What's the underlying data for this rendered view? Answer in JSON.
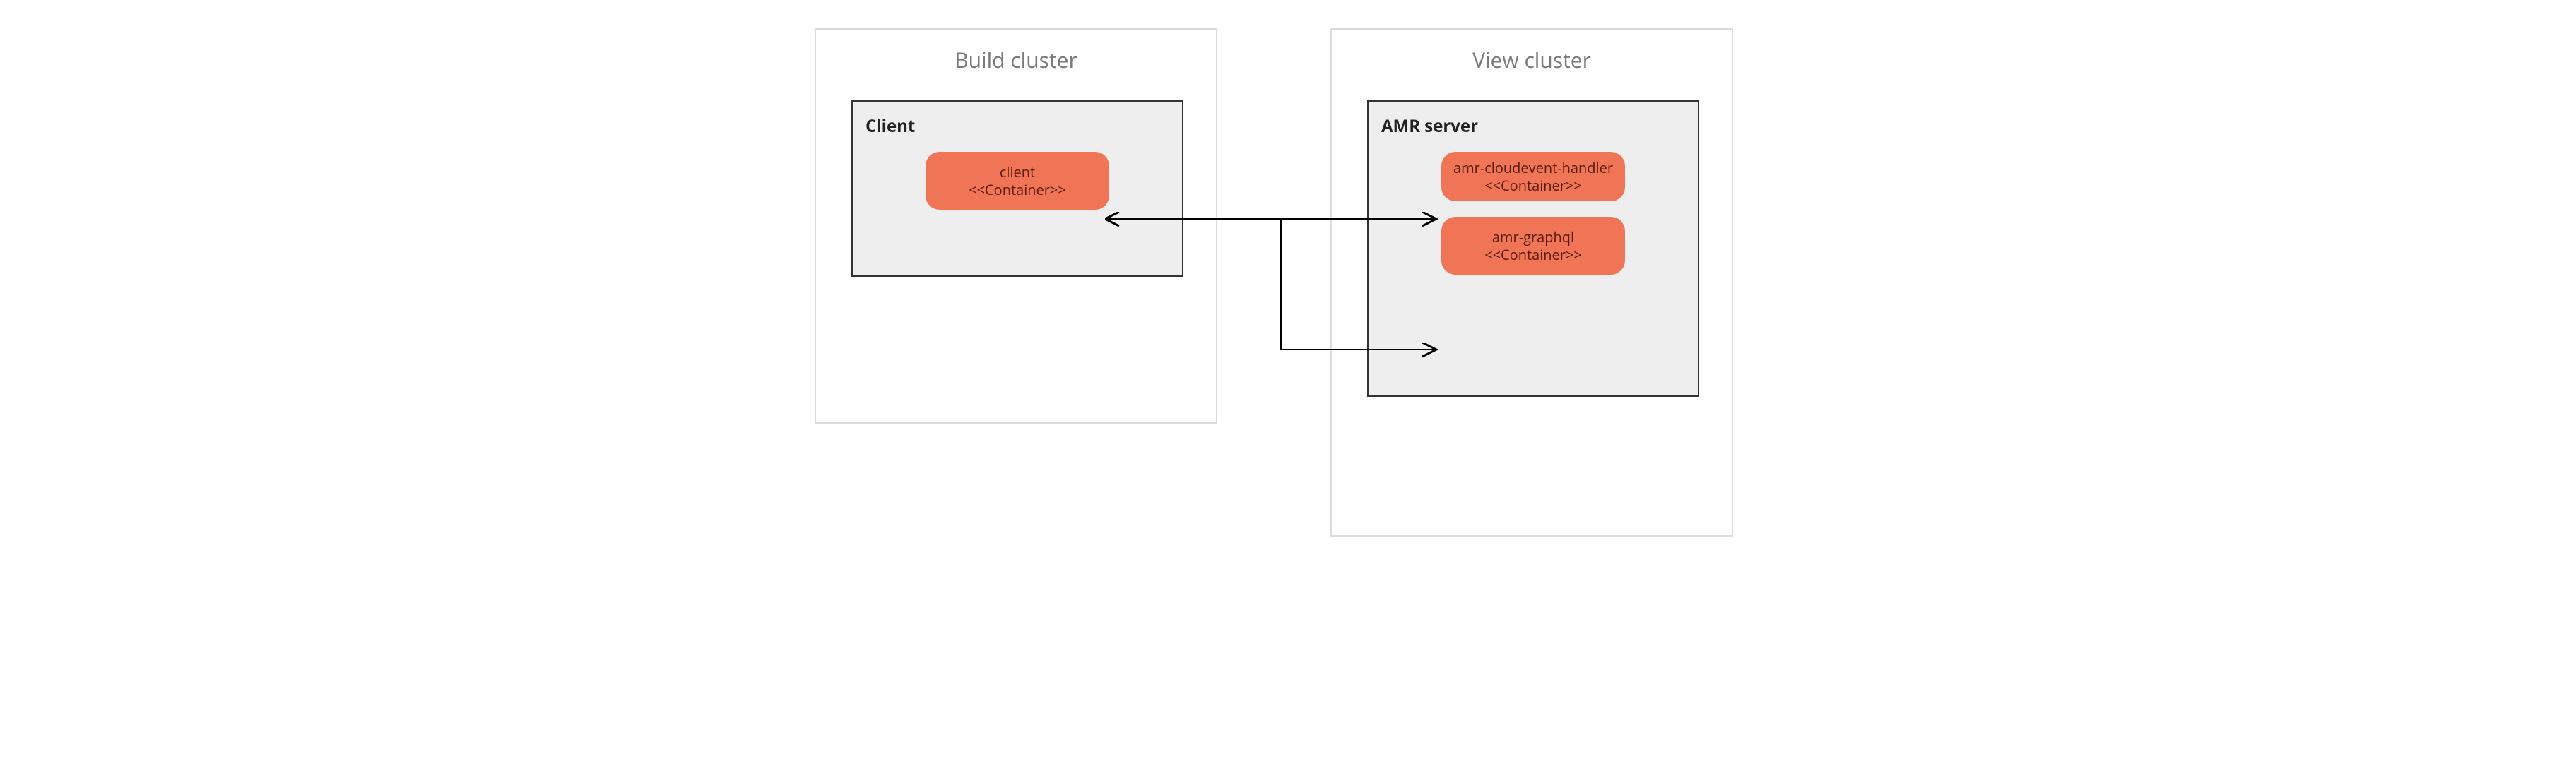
{
  "buildCluster": {
    "title": "Build cluster",
    "panel": {
      "title": "Client",
      "containers": [
        {
          "name": "client",
          "stereotype": "<<Container>>"
        }
      ]
    }
  },
  "viewCluster": {
    "title": "View cluster",
    "panel": {
      "title": "AMR server",
      "containers": [
        {
          "name": "amr-cloudevent-handler",
          "stereotype": "<<Container>>"
        },
        {
          "name": "amr-graphql",
          "stereotype": "<<Container>>"
        }
      ]
    }
  }
}
